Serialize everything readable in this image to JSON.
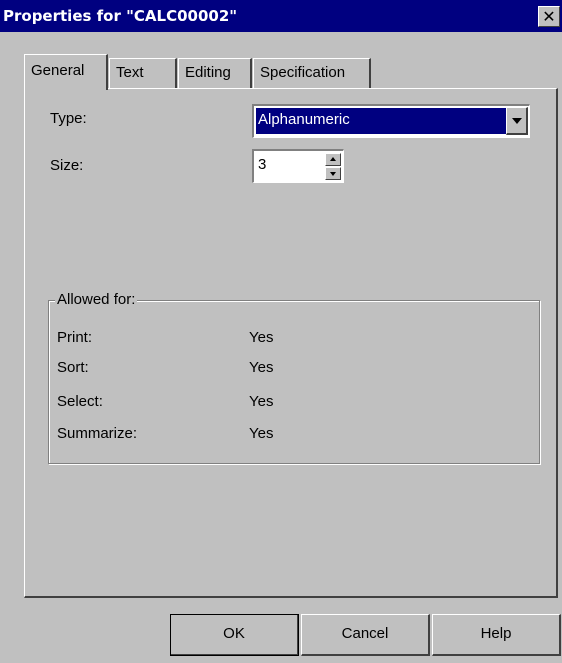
{
  "window": {
    "title": "Properties for \"CALC00002\"",
    "close_glyph": "✕"
  },
  "tabs": [
    {
      "label": "General",
      "active": true
    },
    {
      "label": "Text",
      "active": false
    },
    {
      "label": "Editing",
      "active": false
    },
    {
      "label": "Specification",
      "active": false
    }
  ],
  "general": {
    "type_label": "Type:",
    "type_value": "Alphanumeric",
    "size_label": "Size:",
    "size_value": "3"
  },
  "allowed": {
    "title": "Allowed for:",
    "rows": [
      {
        "label": "Print:",
        "value": "Yes"
      },
      {
        "label": "Sort:",
        "value": "Yes"
      },
      {
        "label": "Select:",
        "value": "Yes"
      },
      {
        "label": "Summarize:",
        "value": "Yes"
      }
    ]
  },
  "buttons": {
    "ok": "OK",
    "cancel": "Cancel",
    "help": "Help"
  },
  "colors": {
    "titlebar": "#000080",
    "face": "#c0c0c0",
    "selection": "#000080"
  }
}
